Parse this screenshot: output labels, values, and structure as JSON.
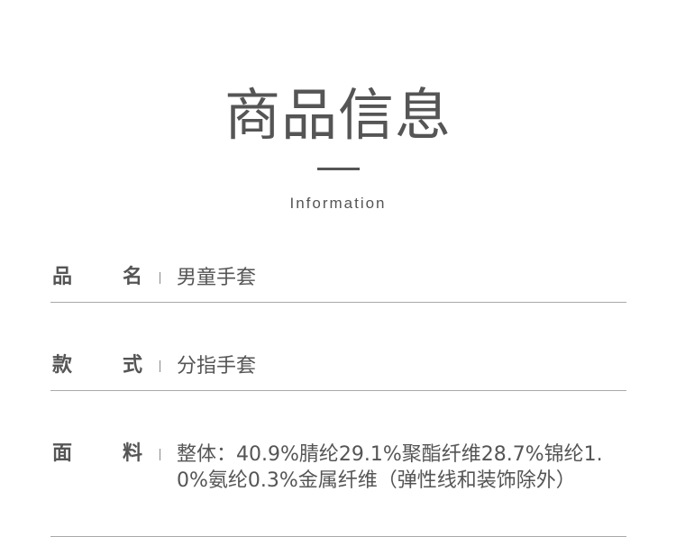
{
  "header": {
    "title": "商品信息",
    "subtitle": "Information"
  },
  "rows": [
    {
      "label_a": "品",
      "label_b": "名",
      "value": "男童手套"
    },
    {
      "label_a": "款",
      "label_b": "式",
      "value": "分指手套"
    },
    {
      "label_a": "面",
      "label_b": "料",
      "value": "整体：40.9%腈纶29.1%聚酯纤维28.7%锦纶1.0%氨纶0.3%金属纤维（弹性线和装饰除外）"
    }
  ]
}
